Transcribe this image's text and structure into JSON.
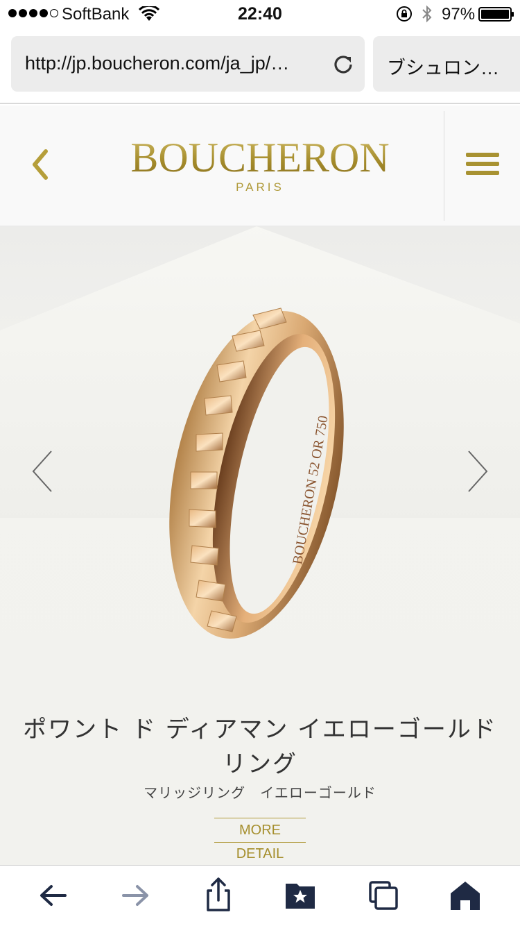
{
  "status_bar": {
    "carrier": "SoftBank",
    "signal_bars_filled": 4,
    "signal_bars_total": 5,
    "time": "22:40",
    "battery_percent": "97%",
    "icons": [
      "wifi-icon",
      "orientation-lock-icon",
      "bluetooth-icon",
      "battery-icon"
    ]
  },
  "browser": {
    "url": "http://jp.boucheron.com/ja_jp/…",
    "tab_title": "ブシュロン…"
  },
  "site_header": {
    "brand": "BOUCHERON",
    "brand_sub": "PARIS",
    "accent_color": "#a89232"
  },
  "product": {
    "title_line1": "ポワント ド ディアマン イエローゴールド",
    "title_line2": "リング",
    "category": "マリッジリング　イエローゴールド",
    "more_detail_label": "MORE DETAIL",
    "engraving": [
      "BOUCHERON",
      "52",
      "OR 750"
    ]
  },
  "toolbar": {
    "buttons": [
      "back-icon",
      "forward-icon",
      "share-icon",
      "bookmarks-icon",
      "tabs-icon",
      "home-icon"
    ],
    "icon_color": "#1f2a44",
    "disabled_color": "#8a93a8"
  }
}
